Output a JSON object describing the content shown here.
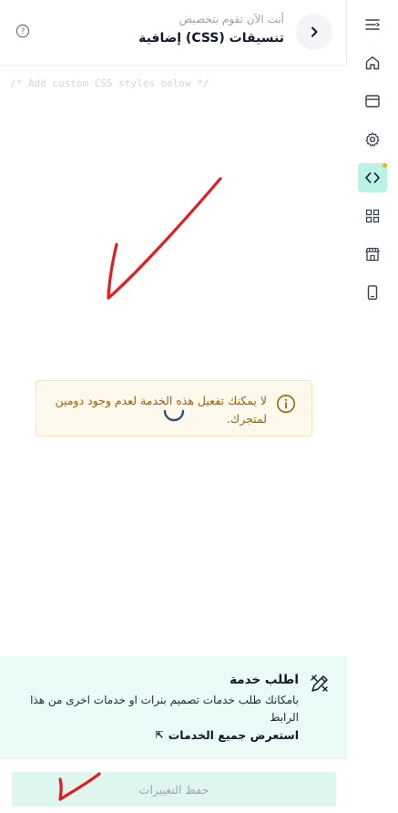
{
  "header": {
    "subtitle": "أنت الآن تقوم بتخصيص",
    "title": "تنسيقات (CSS) إضافية"
  },
  "editor": {
    "placeholder": "/* Add custom CSS styles below */"
  },
  "notice": {
    "text": "لا يمكنك تفعيل هذه الخدمة لعدم وجود دومين لمتجرك."
  },
  "service": {
    "title": "اطلب خدمة",
    "description": "بامكانك طلب خدمات تصميم بنرات او خدمات اخرى من هذا الرابط",
    "link_label": "استعرض جميع الخدمات"
  },
  "footer": {
    "save_label": "حفظ التغييرات"
  },
  "sidebar": {
    "items": [
      {
        "icon": "menu-lines-icon"
      },
      {
        "icon": "home-icon"
      },
      {
        "icon": "browser-window-icon"
      },
      {
        "icon": "gear-icon"
      },
      {
        "icon": "code-icon",
        "active": true
      },
      {
        "icon": "grid-icon"
      },
      {
        "icon": "store-icon"
      },
      {
        "icon": "mobile-icon"
      }
    ]
  },
  "colors": {
    "accent": "#baf3e6",
    "notice_bg": "#fff8ec",
    "notice_text": "#a16207",
    "service_bg": "#eafaf6",
    "annotation": "#e11d1d"
  }
}
